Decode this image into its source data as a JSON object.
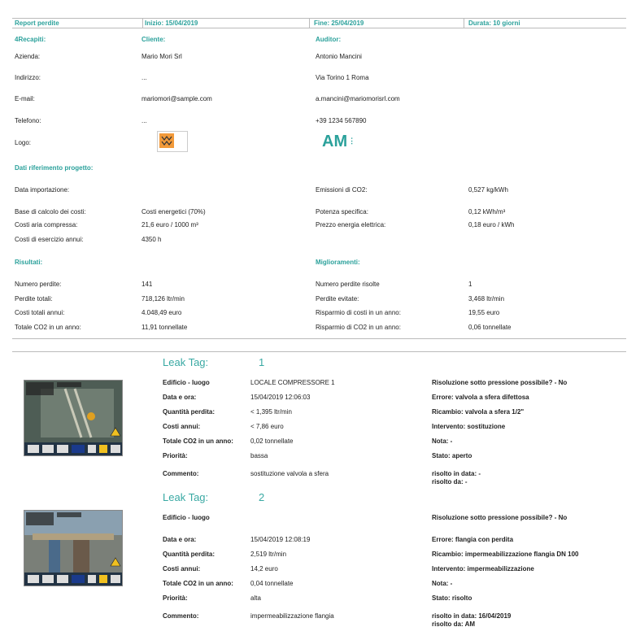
{
  "header": {
    "report": "Report perdite",
    "start": "Inizio: 15/04/2019",
    "end": "Fine: 25/04/2019",
    "duration": "Durata: 10 giorni"
  },
  "contacts": {
    "section": "4Recapiti:",
    "client_head": "Cliente:",
    "auditor_head": "Auditor:",
    "rows": [
      {
        "label": "Azienda:",
        "client": "Mario Mori Srl",
        "auditor": "Antonio Mancini"
      },
      {
        "label": "Indirizzo:",
        "client": "...",
        "auditor": "Via Torino 1 Roma"
      },
      {
        "label": "E-mail:",
        "client": "mariomori@sample.com",
        "auditor": "a.mancini@mariomorisrl.com"
      },
      {
        "label": "Telefono:",
        "client": "...",
        "auditor": "+39 1234 567890"
      },
      {
        "label": "Logo:",
        "client": "",
        "auditor": ""
      }
    ],
    "auditor_logo_text": "AM"
  },
  "project": {
    "section": "Dati riferimento progetto:",
    "rows": [
      {
        "l1": "Data importazione:",
        "v1": "",
        "l2": "Emissioni di CO2:",
        "v2": "0,527 kg/kWh"
      },
      {
        "l1": "Base di calcolo dei costi:",
        "v1": "Costi energetici (70%)",
        "l2": "Potenza specifica:",
        "v2": "0,12 kWh/m³"
      },
      {
        "l1": "Costi aria compressa:",
        "v1": "21,6 euro / 1000 m³",
        "l2": "Prezzo energia elettrica:",
        "v2": "0,18 euro / kWh"
      },
      {
        "l1": "Costi di esercizio annui:",
        "v1": "4350 h",
        "l2": "",
        "v2": ""
      }
    ]
  },
  "results": {
    "section": "Risultati:",
    "improvements": "Miglioramenti:",
    "rows": [
      {
        "l1": "Numero perdite:",
        "v1": "141",
        "l2": "Numero perdite risolte",
        "v2": "1"
      },
      {
        "l1": "Perdite totali:",
        "v1": "718,126 ltr/min",
        "l2": "Perdite evitate:",
        "v2": "3,468 ltr/min"
      },
      {
        "l1": "Costi totali annui:",
        "v1": "4.048,49 euro",
        "l2": "Risparmio di costi in un anno:",
        "v2": "19,55 euro"
      },
      {
        "l1": "Totale CO2 in un anno:",
        "v1": "11,91 tonnellate",
        "l2": "Risparmio di CO2 in un anno:",
        "v2": "0,06 tonnellate"
      }
    ]
  },
  "tags": [
    {
      "title": "Leak Tag:",
      "num": "1",
      "labels": [
        "Edificio - luogo",
        "Data e ora:",
        "Quantità perdita:",
        "Costi annui:",
        "Totale CO2 in un anno:",
        "Priorità:",
        "Commento:"
      ],
      "values": [
        "LOCALE COMPRESSORE 1",
        "15/04/2019 12:06:03",
        "< 1,395 ltr/min",
        "< 7,86 euro",
        "0,02 tonnellate",
        "bassa",
        "sostituzione valvola a sfera"
      ],
      "right": [
        "Risoluzione sotto pressione possibile? - No",
        "Errore: valvola a sfera difettosa",
        "Ricambio: valvola a sfera 1/2\"",
        "Intervento: sostituzione",
        "Nota: -",
        "Stato: aperto",
        "risolto in data: -"
      ],
      "right_extra": "risolto da: -"
    },
    {
      "title": "Leak Tag:",
      "num": "2",
      "labels": [
        "Edificio - luogo",
        "Data e ora:",
        "Quantità perdita:",
        "Costi annui:",
        "Totale CO2 in un anno:",
        "Priorità:",
        "Commento:"
      ],
      "values": [
        "",
        "15/04/2019 12:08:19",
        "2,519 ltr/min",
        "14,2 euro",
        "0,04 tonnellate",
        "alta",
        "impermeabilizzazione flangia"
      ],
      "right": [
        "Risoluzione sotto pressione possibile? - No",
        "Errore: flangia con perdita",
        "Ricambio: impermeabilizzazione flangia DN 100",
        "Intervento: impermeabilizzazione",
        "Nota: -",
        "Stato: risolto",
        "risolto in data: 16/04/2019"
      ],
      "right_extra": "risolto da: AM"
    }
  ],
  "colors": {
    "accent": "#2ba19b",
    "rule": "#bbbbbb"
  }
}
